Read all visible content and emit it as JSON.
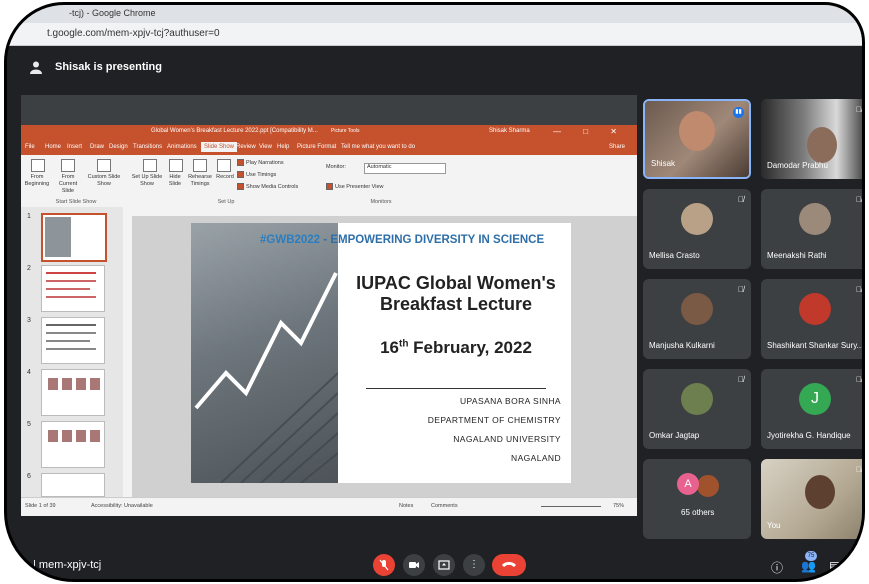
{
  "browser": {
    "window_title": "-tcj) - Google Chrome",
    "url": "t.google.com/mem-xpjv-tcj?authuser=0"
  },
  "presenter_bar": {
    "text": "Shisak is presenting"
  },
  "powerpoint": {
    "doc_title": "Global Women's Breakfast Lecture 2022.ppt [Compatibility M...",
    "picture_tools": "Picture Tools",
    "user": "Shisak Sharma",
    "tabs": [
      "File",
      "Home",
      "Insert",
      "Draw",
      "Design",
      "Transitions",
      "Animations",
      "Slide Show",
      "Review",
      "View",
      "Help",
      "Picture Format"
    ],
    "active_tab": "Slide Show",
    "tell_me": "Tell me what you want to do",
    "share": "Share",
    "ribbon": {
      "from_beginning": "From Beginning",
      "from_current": "From Current Slide",
      "custom_show": "Custom Slide Show",
      "group_start": "Start Slide Show",
      "set_up": "Set Up Slide Show",
      "hide_slide": "Hide Slide",
      "rehearse": "Rehearse Timings",
      "record": "Record",
      "play_narrations": "Play Narrations",
      "use_timings": "Use Timings",
      "show_media": "Show Media Controls",
      "group_setup": "Set Up",
      "monitor_label": "Monitor:",
      "monitor_value": "Automatic",
      "presenter_view": "Use Presenter View",
      "group_monitors": "Monitors"
    },
    "slide_numbers": [
      "1",
      "2",
      "3",
      "4",
      "5",
      "6"
    ],
    "slide": {
      "hashtag": "#GWB2022",
      "tagline": " - EMPOWERING DIVERSITY IN SCIENCE",
      "title_line1": "IUPAC Global Women's",
      "title_line2": "Breakfast Lecture",
      "date_day": "16",
      "date_suffix": "th",
      "date_rest": " February, 2022",
      "author": "UPASANA BORA SINHA",
      "dept": "DEPARTMENT OF CHEMISTRY",
      "university": "NAGALAND UNIVERSITY",
      "state": "NAGALAND"
    },
    "status": {
      "slide_of": "Slide 1 of 39",
      "accessibility": "Accessibility: Unavailable",
      "notes": "Notes",
      "comments": "Comments",
      "zoom": "75%"
    }
  },
  "participants": [
    {
      "name": "Shisak"
    },
    {
      "name": "Damodar Prabhu"
    },
    {
      "name": "Mellisa Crasto"
    },
    {
      "name": "Meenakshi Rathi"
    },
    {
      "name": "Manjusha Kulkarni"
    },
    {
      "name": "Shashikant Shankar Sury..."
    },
    {
      "name": "Omkar Jagtap"
    },
    {
      "name": "Jyotirekha G. Handique"
    },
    {
      "name": "65 others"
    },
    {
      "name": "You"
    }
  ],
  "others_initial": "A",
  "jyotirekha_initial": "J",
  "bottom": {
    "meeting_code": "mem-xpjv-tcj",
    "people_count": "75"
  },
  "colors": {
    "ppt_accent": "#c5512d",
    "meet_bg": "#202124",
    "end_call": "#ea4335"
  }
}
